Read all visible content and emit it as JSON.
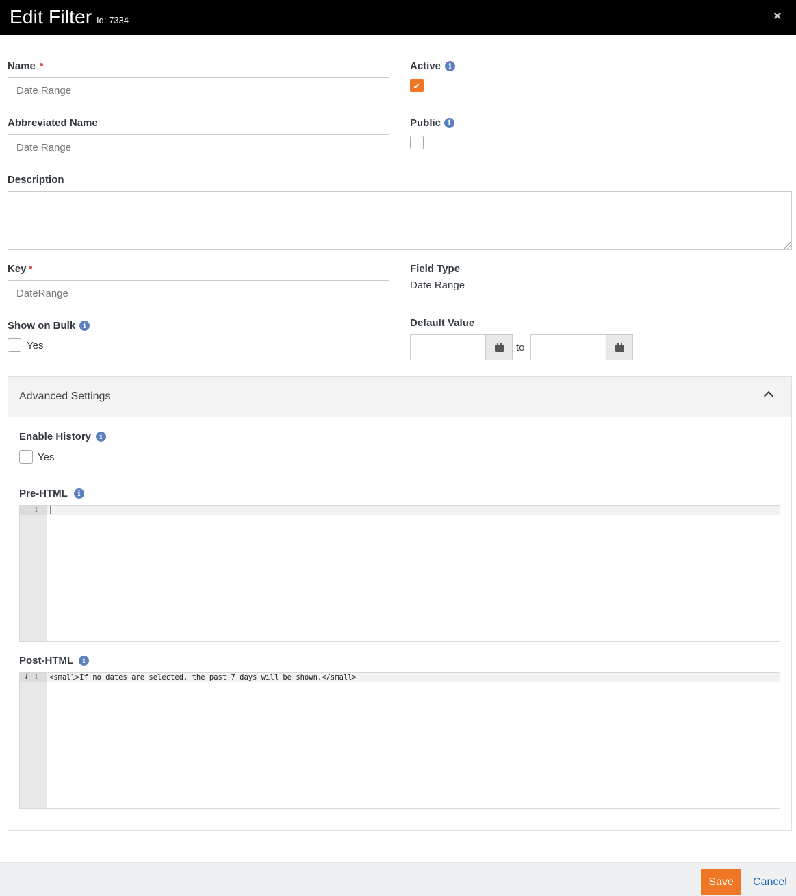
{
  "dialog": {
    "title": "Edit Filter",
    "id_label": "Id: 7334",
    "close_icon": "×"
  },
  "form": {
    "name": {
      "label": "Name",
      "value": "Date Range"
    },
    "active": {
      "label": "Active",
      "checked": true,
      "check_glyph": "✔"
    },
    "abbreviated_name": {
      "label": "Abbreviated Name",
      "value": "Date Range"
    },
    "public": {
      "label": "Public",
      "checked": false
    },
    "description": {
      "label": "Description",
      "value": ""
    },
    "key": {
      "label": "Key",
      "value": "DateRange"
    },
    "field_type": {
      "label": "Field Type",
      "value": "Date Range"
    },
    "show_on_bulk": {
      "label": "Show on Bulk",
      "option": "Yes",
      "checked": false
    },
    "default_value": {
      "label": "Default Value",
      "separator": "to",
      "from": "",
      "to": ""
    },
    "info_glyph": "i"
  },
  "advanced": {
    "title": "Advanced Settings",
    "expanded": true,
    "enable_history": {
      "label": "Enable History",
      "option": "Yes",
      "checked": false
    },
    "pre_html": {
      "label": "Pre-HTML",
      "line_number": "1",
      "code": ""
    },
    "post_html": {
      "label": "Post-HTML",
      "line_number": "1",
      "info_marker": "i",
      "code": "<small>If no dates are selected, the past 7 days will be shown.</small>"
    }
  },
  "footer": {
    "save_label": "Save",
    "cancel_label": "Cancel"
  },
  "colors": {
    "accent": "#ee7624",
    "required": "#d9534f",
    "info": "#5b7fbf",
    "link": "#1f6fb8",
    "header": "#000000"
  }
}
